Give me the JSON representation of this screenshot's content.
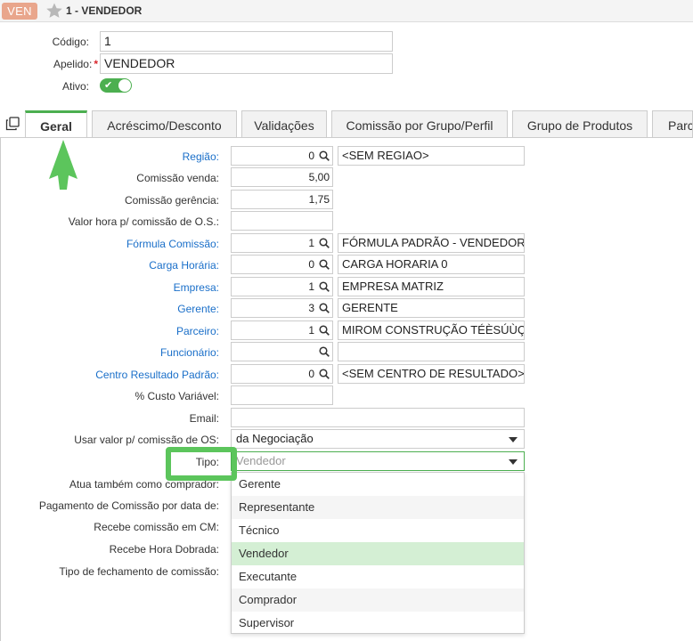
{
  "titlebar": {
    "badge": "VEN",
    "title": "1 - VENDEDOR"
  },
  "header": {
    "codigo_label": "Código:",
    "codigo_value": "1",
    "apelido_label": "Apelido:",
    "required_mark": "*",
    "apelido_value": "VENDEDOR",
    "ativo_label": "Ativo:",
    "ativo_check": "✔",
    "ativo_on": true
  },
  "tabs": [
    {
      "label": "Geral",
      "active": true
    },
    {
      "label": "Acréscimo/Desconto"
    },
    {
      "label": "Validações"
    },
    {
      "label": "Comissão por Grupo/Perfil"
    },
    {
      "label": "Grupo de Produtos"
    },
    {
      "label": "Parc"
    }
  ],
  "form": {
    "regiao": {
      "label": "Região:",
      "code": "0",
      "desc": "<SEM REGIAO>"
    },
    "comissao_venda": {
      "label": "Comissão venda:",
      "value": "5,00"
    },
    "comissao_gerencia": {
      "label": "Comissão gerência:",
      "value": "1,75"
    },
    "valor_hora": {
      "label": "Valor hora p/ comissão de O.S.:",
      "value": ""
    },
    "formula": {
      "label": "Fórmula Comissão:",
      "code": "1",
      "desc": "FÓRMULA PADRÃO - VENDEDOR"
    },
    "carga": {
      "label": "Carga Horária:",
      "code": "0",
      "desc": "CARGA HORARIA 0"
    },
    "empresa": {
      "label": "Empresa:",
      "code": "1",
      "desc": "EMPRESA MATRIZ"
    },
    "gerente": {
      "label": "Gerente:",
      "code": "3",
      "desc": "GERENTE"
    },
    "parceiro": {
      "label": "Parceiro:",
      "code": "1",
      "desc": "MIROM CONSTRUÇÃO TÉÈSÚÙÇ"
    },
    "funcionario": {
      "label": "Funcionário:",
      "code": "",
      "desc": ""
    },
    "centro": {
      "label": "Centro Resultado Padrão:",
      "code": "0",
      "desc": "<SEM CENTRO DE RESULTADO>"
    },
    "custo_variavel": {
      "label": "% Custo Variável:",
      "value": ""
    },
    "email": {
      "label": "Email:",
      "value": ""
    },
    "usar_valor": {
      "label": "Usar valor p/ comissão de OS:",
      "value": "da Negociação"
    },
    "tipo": {
      "label": "Tipo:",
      "value": "Vendedor"
    },
    "atua_comprador": {
      "label": "Atua também como comprador:"
    },
    "pagamento": {
      "label": "Pagamento de Comissão por data de:"
    },
    "recebe_cm": {
      "label": "Recebe comissão em CM:"
    },
    "recebe_hora": {
      "label": "Recebe Hora Dobrada:"
    },
    "tipo_fechamento": {
      "label": "Tipo de fechamento de comissão:"
    }
  },
  "dropdown": {
    "options": [
      "Gerente",
      "Representante",
      "Técnico",
      "Vendedor",
      "Executante",
      "Comprador",
      "Supervisor"
    ],
    "selected": "Vendedor"
  },
  "colors": {
    "accent_green": "#4caf50",
    "link_blue": "#1a6fc9",
    "badge": "#e9a68c",
    "selected_option": "#d4efd4",
    "annotation": "#5cc55c"
  }
}
